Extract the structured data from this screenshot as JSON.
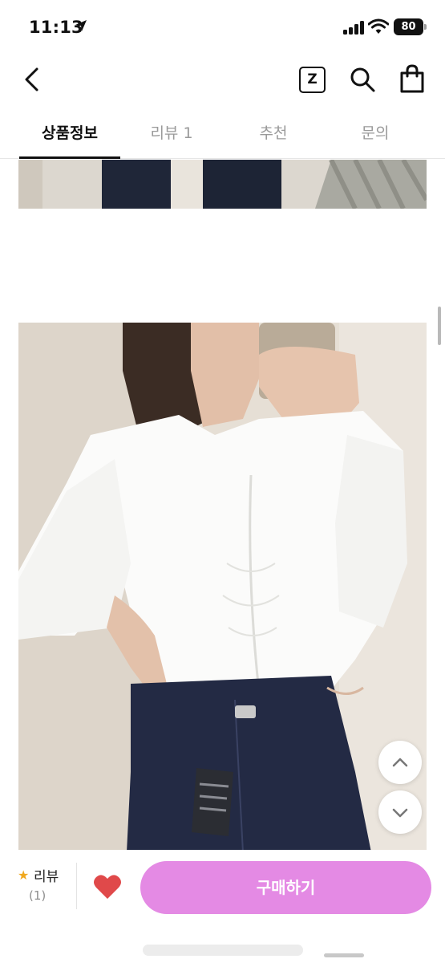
{
  "status_bar": {
    "time": "11:13",
    "battery": "80"
  },
  "header": {
    "z_label": "Z"
  },
  "tabs": [
    {
      "label": "상품정보",
      "active": true
    },
    {
      "label": "리뷰 1",
      "active": false
    },
    {
      "label": "추천",
      "active": false
    },
    {
      "label": "문의",
      "active": false
    }
  ],
  "bottom_bar": {
    "review_label": "리뷰",
    "review_count": "(1)",
    "buy_label": "구매하기"
  },
  "colors": {
    "accent": "#e48ae4",
    "heart": "#e0494a",
    "star": "#f0a81e"
  },
  "icons": [
    "back-chevron-icon",
    "z-box-icon",
    "search-icon",
    "shopping-bag-icon",
    "chevron-up-icon",
    "chevron-down-icon",
    "star-icon",
    "heart-icon"
  ]
}
